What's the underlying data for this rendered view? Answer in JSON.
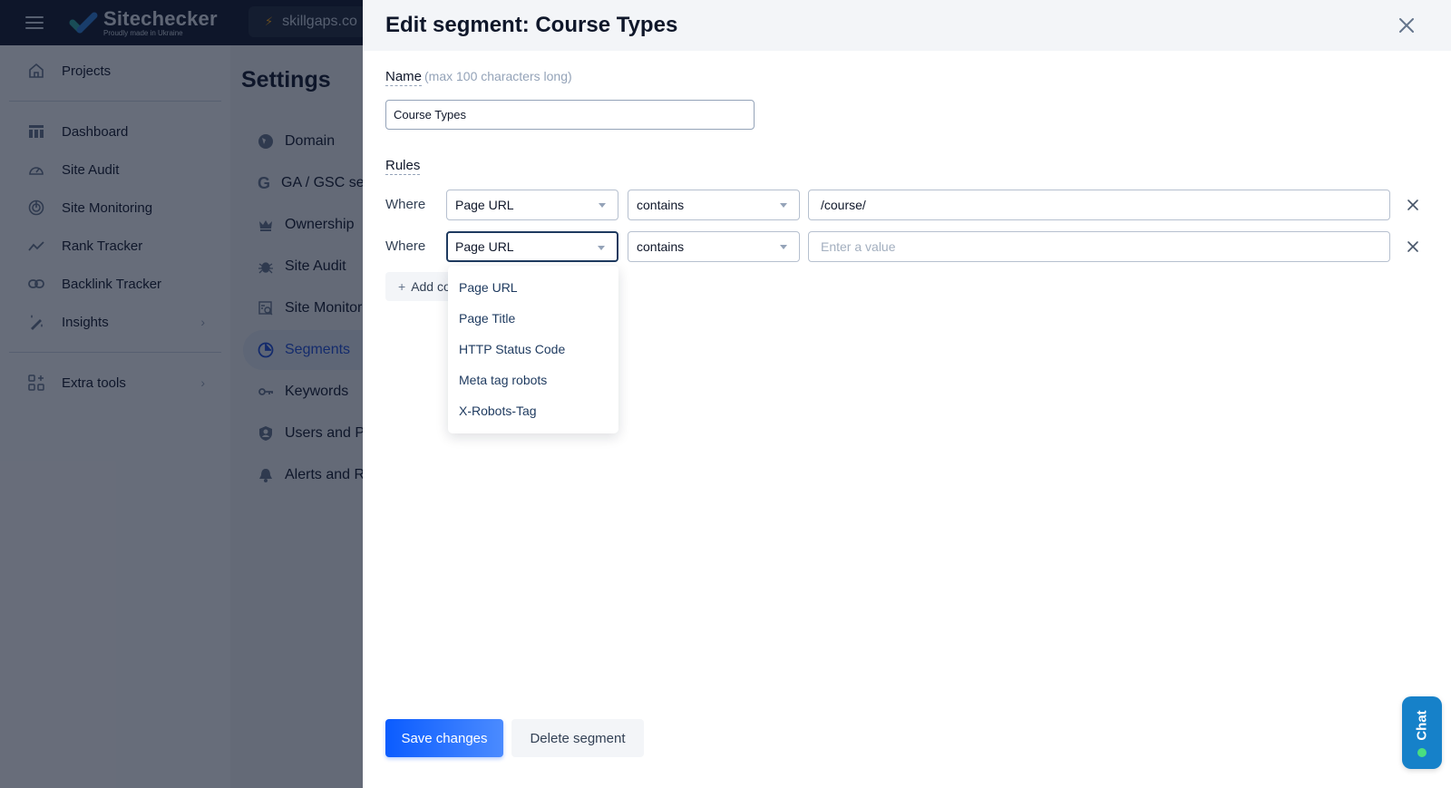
{
  "topbar": {
    "logo_name": "Sitechecker",
    "logo_tagline": "Proudly made in Ukraine",
    "project_name": "skillgaps.co"
  },
  "sidebar": {
    "items": [
      {
        "label": "Projects",
        "icon": "home-icon"
      },
      {
        "label": "Dashboard",
        "icon": "dashboard-icon"
      },
      {
        "label": "Site Audit",
        "icon": "gauge-icon"
      },
      {
        "label": "Site Monitoring",
        "icon": "radar-icon"
      },
      {
        "label": "Rank Tracker",
        "icon": "trend-line-icon"
      },
      {
        "label": "Backlink Tracker",
        "icon": "link-icon"
      },
      {
        "label": "Insights",
        "icon": "magic-wand-icon",
        "has_submenu": true
      },
      {
        "label": "Extra tools",
        "icon": "add-grid-icon",
        "has_submenu": true
      }
    ]
  },
  "settings": {
    "title": "Settings",
    "items": [
      {
        "label": "Domain",
        "icon": "globe-icon"
      },
      {
        "label": "GA / GSC settings",
        "icon": "google-icon"
      },
      {
        "label": "Ownership",
        "icon": "crown-icon"
      },
      {
        "label": "Site Audit",
        "icon": "bug-icon"
      },
      {
        "label": "Site Monitoring",
        "icon": "monitor-search-icon"
      },
      {
        "label": "Segments",
        "icon": "pie-chart-icon",
        "active": true
      },
      {
        "label": "Keywords",
        "icon": "key-icon"
      },
      {
        "label": "Users and Permissions",
        "icon": "user-shield-icon"
      },
      {
        "label": "Alerts and Reports",
        "icon": "bell-icon"
      }
    ]
  },
  "drawer": {
    "title": "Edit segment: Course Types",
    "name_label": "Name",
    "name_hint": "(max 100 characters long)",
    "name_value": "Course Types",
    "rules_label": "Rules",
    "rules": [
      {
        "where": "Where",
        "field": "Page URL",
        "operator": "contains",
        "value": "/course/",
        "placeholder": "Enter a value"
      },
      {
        "where": "Where",
        "field": "Page URL",
        "operator": "contains",
        "value": "",
        "placeholder": "Enter a value"
      }
    ],
    "add_condition_label": "Add condition",
    "field_options": [
      "Page URL",
      "Page Title",
      "HTTP Status Code",
      "Meta tag robots",
      "X-Robots-Tag"
    ],
    "save_label": "Save changes",
    "delete_label": "Delete segment"
  },
  "chat": {
    "label": "Chat",
    "status_color": "#4ade80"
  },
  "colors": {
    "primary": "#0b5cff",
    "active_nav": "#1d4ed8",
    "chat": "#1681c9"
  }
}
